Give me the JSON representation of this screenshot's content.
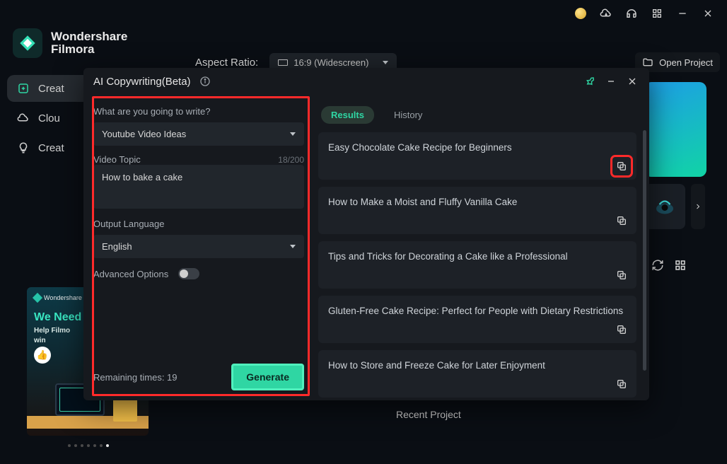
{
  "app": {
    "brand1": "Wondershare",
    "brand2": "Filmora"
  },
  "titlebar_icons": [
    "crown-icon",
    "cloud-download-icon",
    "headset-icon",
    "grid-icon",
    "minimize-icon",
    "close-icon"
  ],
  "sidebar": {
    "items": [
      {
        "label": "Creat",
        "icon": "plus-square-icon",
        "active": true
      },
      {
        "label": "Clou",
        "icon": "cloud-icon",
        "active": false
      },
      {
        "label": "Creat",
        "icon": "bulb-icon",
        "active": false
      }
    ]
  },
  "promo": {
    "brand": "Wondershare Filmora",
    "headline": "We Need",
    "sub": "Help Filmo",
    "win": "win"
  },
  "toolbar": {
    "aspect_label": "Aspect Ratio:",
    "aspect_value": "16:9 (Widescreen)",
    "open_project": "Open Project"
  },
  "recent_label": "Recent Project",
  "modal": {
    "title": "AI Copywriting(Beta)",
    "left": {
      "q_label": "What are you going to write?",
      "type_value": "Youtube Video Ideas",
      "topic_label": "Video Topic",
      "topic_value": "How to bake a cake",
      "counter": "18/200",
      "lang_label": "Output Language",
      "lang_value": "English",
      "adv_label": "Advanced Options",
      "remaining": "Remaining times: 19",
      "generate": "Generate"
    },
    "right": {
      "tab_results": "Results",
      "tab_history": "History",
      "results": [
        "Easy Chocolate Cake Recipe for Beginners",
        "How to Make a Moist and Fluffy Vanilla Cake",
        "Tips and Tricks for Decorating a Cake like a Professional",
        "Gluten-Free Cake Recipe: Perfect for People with Dietary Restrictions",
        "How to Store and Freeze Cake for Later Enjoyment"
      ]
    }
  }
}
